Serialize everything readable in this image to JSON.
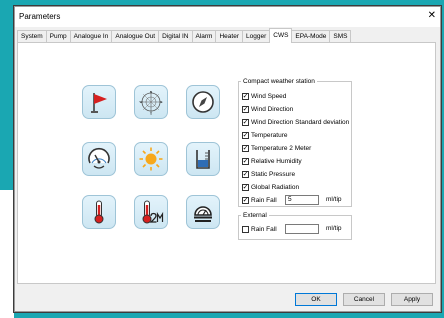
{
  "window": {
    "title": "Parameters"
  },
  "tabs": [
    "System",
    "Pump",
    "Analogue In",
    "Analogue Out",
    "Digital IN",
    "Alarm",
    "Heater",
    "Logger",
    "CWS",
    "EPA-Mode",
    "SMS"
  ],
  "active_tab": "CWS",
  "icons": [
    "weather-flag-icon",
    "wind-rose-icon",
    "compass-icon",
    "pressure-gauge-icon",
    "sun-icon",
    "rain-gauge-icon",
    "thermometer-icon",
    "thermometer-2m-icon",
    "weather-dome-icon"
  ],
  "compact_station": {
    "legend": "Compact weather station",
    "items": [
      {
        "label": "Wind Speed",
        "checked": true
      },
      {
        "label": "Wind Direction",
        "checked": true
      },
      {
        "label": "Wind Direction Standard deviation",
        "checked": true
      },
      {
        "label": "Temperature",
        "checked": true
      },
      {
        "label": "Temperature 2 Meter",
        "checked": true
      },
      {
        "label": "Relative Humidity",
        "checked": true
      },
      {
        "label": "Static Pressure",
        "checked": true
      },
      {
        "label": "Global Radiation",
        "checked": true
      }
    ],
    "rain_fall": {
      "label": "Rain Fall",
      "checked": true,
      "value": "5",
      "unit": "ml/tip"
    }
  },
  "external": {
    "legend": "External",
    "rain_fall": {
      "label": "Rain Fall",
      "checked": false,
      "value": "",
      "unit": "ml/tip"
    }
  },
  "buttons": {
    "ok": "OK",
    "cancel": "Cancel",
    "apply": "Apply"
  },
  "colors": {
    "background_accent": "#1aa7b2",
    "icon_bg": "#d6ecf6"
  }
}
